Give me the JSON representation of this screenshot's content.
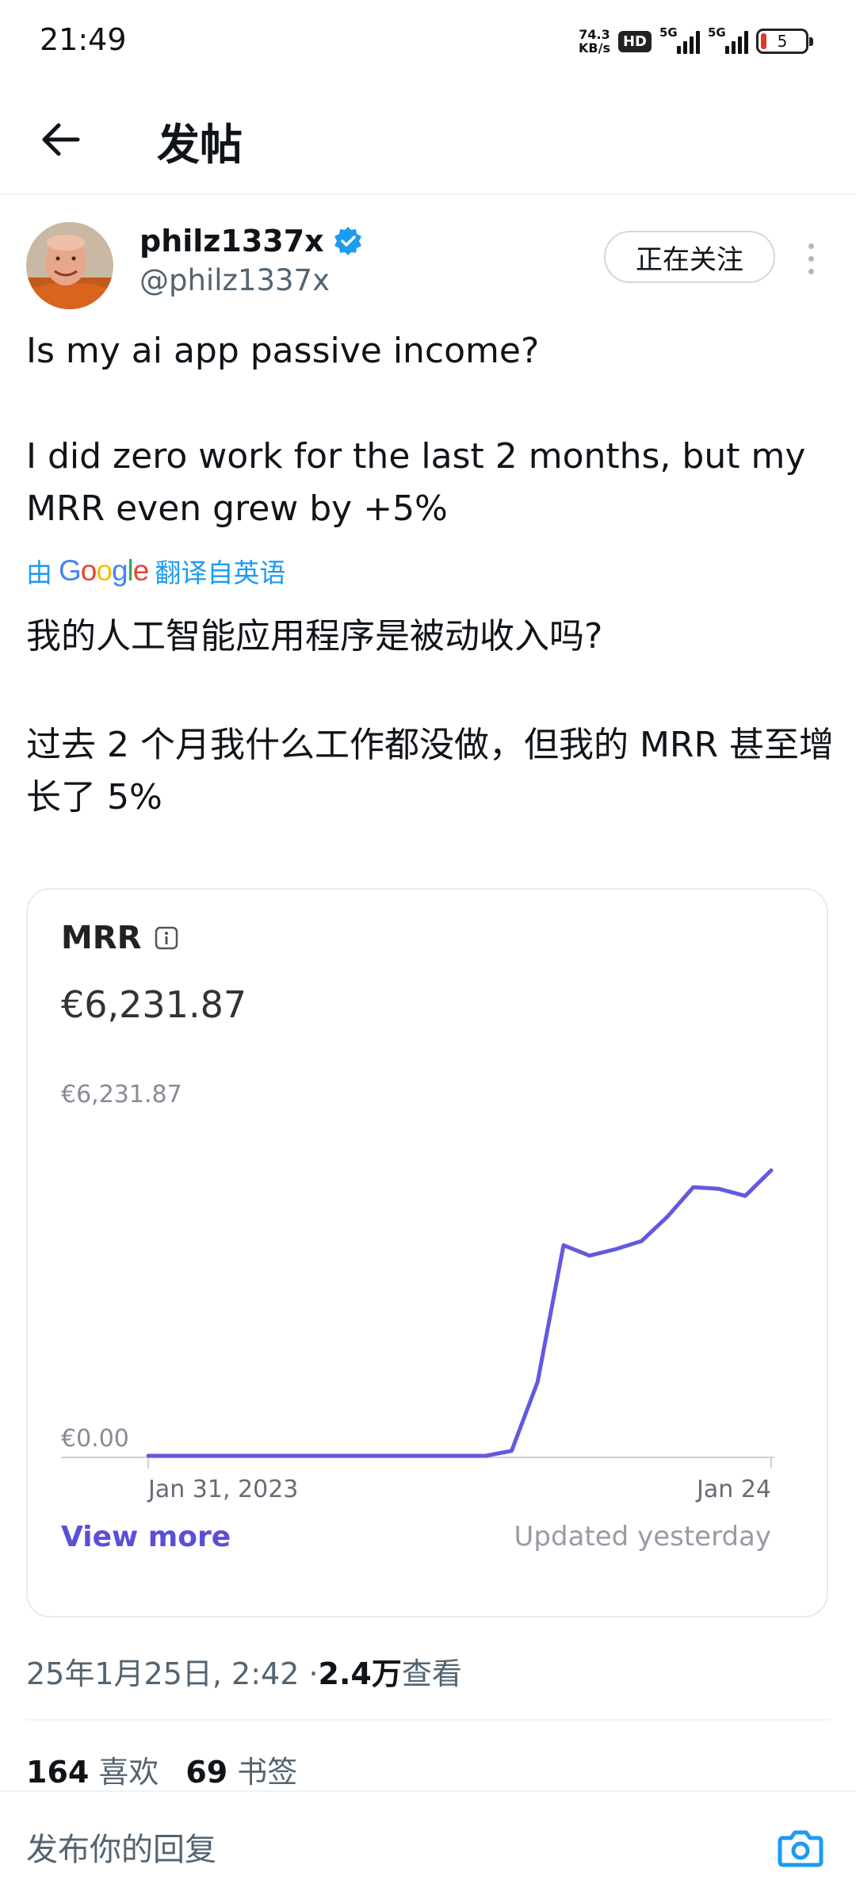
{
  "status_bar": {
    "time": "21:49",
    "net_speed_value": "74.3",
    "net_speed_unit": "KB/s",
    "hd_label": "HD",
    "signal1_label": "5G",
    "signal2_label": "5G",
    "battery_level": "5"
  },
  "header": {
    "title": "发帖"
  },
  "tweet": {
    "author_name": "philz1337x",
    "author_handle": "@philz1337x",
    "follow_label": "正在关注",
    "text_line1": "Is my ai app passive income?",
    "text_line2": "I did zero work for the last 2 months, but my MRR even grew by +5%",
    "translate_prefix": "由",
    "translate_provider": "Google",
    "translate_suffix": "翻译自英语",
    "translated_line1": "我的人工智能应用程序是被动收入吗?",
    "translated_line2": "过去 2 个月我什么工作都没做，但我的 MRR 甚至增长了 5%",
    "timestamp": "25年1月25日, 2:42 · ",
    "views_count": "2.4万",
    "views_label": " 查看",
    "likes_count": "164",
    "likes_label": "喜欢",
    "bookmarks_count": "69",
    "bookmarks_label": "书签"
  },
  "card": {
    "title": "MRR",
    "value": "€6,231.87",
    "view_more": "View more",
    "updated": "Updated yesterday",
    "accent_color": "#5b4fd6"
  },
  "chart_data": {
    "type": "line",
    "title": "MRR",
    "ylim": [
      0,
      6231.87
    ],
    "y_tick_labels": [
      "€6,231.87",
      "€0.00"
    ],
    "x_tick_labels": [
      "Jan 31, 2023",
      "Jan 24"
    ],
    "grid": false,
    "series": [
      {
        "values": [
          0,
          0,
          0,
          0,
          0,
          0,
          0,
          0,
          0,
          0,
          0,
          0,
          0,
          0,
          85,
          1275,
          3630,
          3450,
          3560,
          3700,
          4120,
          4630,
          4600,
          4480,
          4920
        ]
      }
    ],
    "line_color": "#6359e0"
  },
  "reply": {
    "placeholder": "发布你的回复"
  }
}
